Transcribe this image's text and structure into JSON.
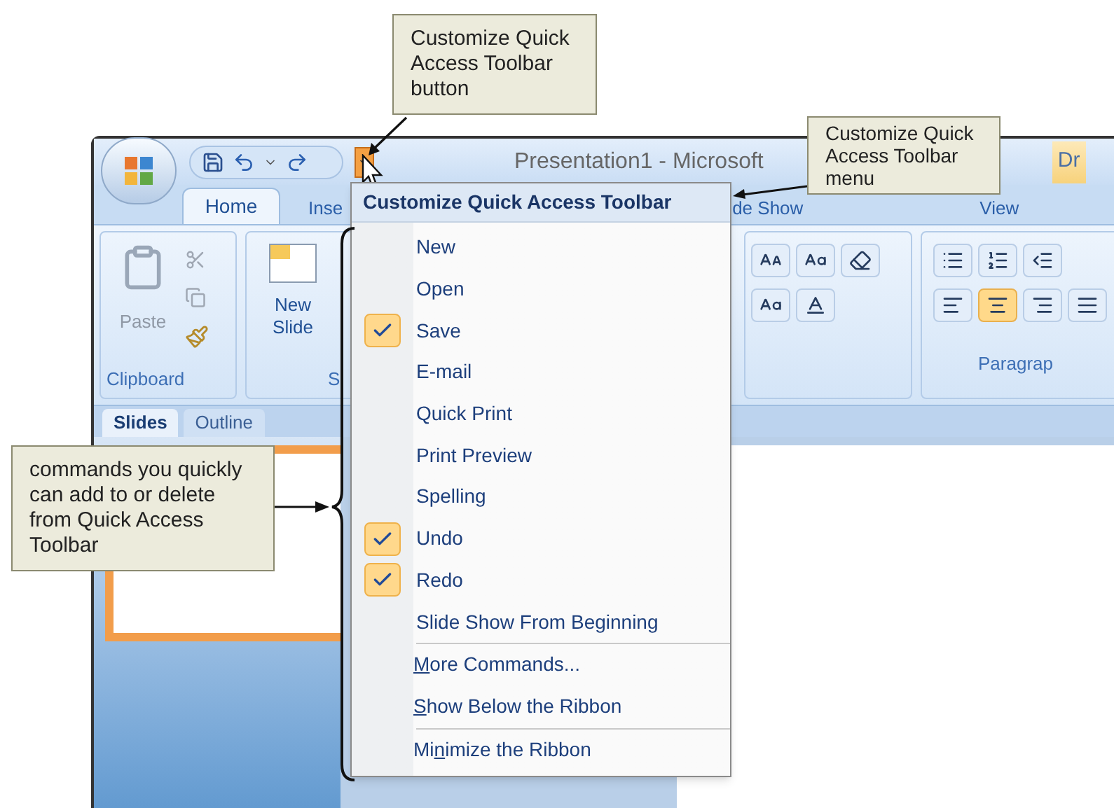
{
  "window": {
    "title": "Presentation1 - Microsoft",
    "contextual_tab": "Dr"
  },
  "ribbon_tabs": [
    {
      "label": "Home",
      "selected": true
    },
    {
      "label": "Inse",
      "selected": false
    },
    {
      "label": "de Show",
      "selected": false
    },
    {
      "label": "View",
      "selected": false
    }
  ],
  "ribbon_groups": [
    {
      "label": "Clipboard"
    },
    {
      "label": "S"
    },
    {
      "label": "Paragrap"
    }
  ],
  "ribbon_buttons": [
    {
      "label": "Paste",
      "disabled": true
    },
    {
      "label": "New Slide",
      "disabled": false
    }
  ],
  "pane_tabs": [
    {
      "label": "Slides",
      "selected": true
    },
    {
      "label": "Outline",
      "selected": false
    }
  ],
  "menu": {
    "title": "Customize Quick Access Toolbar",
    "items": [
      {
        "label": "New",
        "checked": false
      },
      {
        "label": "Open",
        "checked": false
      },
      {
        "label": "Save",
        "checked": true
      },
      {
        "label": "E-mail",
        "checked": false
      },
      {
        "label": "Quick Print",
        "checked": false
      },
      {
        "label": "Print Preview",
        "checked": false
      },
      {
        "label": "Spelling",
        "checked": false
      },
      {
        "label": "Undo",
        "checked": true
      },
      {
        "label": "Redo",
        "checked": true
      },
      {
        "label": "Slide Show From Beginning",
        "checked": false
      }
    ],
    "option_groups": [
      [
        {
          "key": "M",
          "after": "ore Commands..."
        },
        {
          "key": "S",
          "after": "how Below the Ribbon"
        }
      ],
      [
        {
          "before": "Mi",
          "key": "n",
          "after": "imize the Ribbon"
        }
      ]
    ]
  },
  "callouts": [
    {
      "text": "Customize Quick Access Toolbar button"
    },
    {
      "text": "Customize Quick Access Toolbar menu"
    },
    {
      "text": "commands you quickly can add to or delete from Quick Access Toolbar"
    }
  ]
}
